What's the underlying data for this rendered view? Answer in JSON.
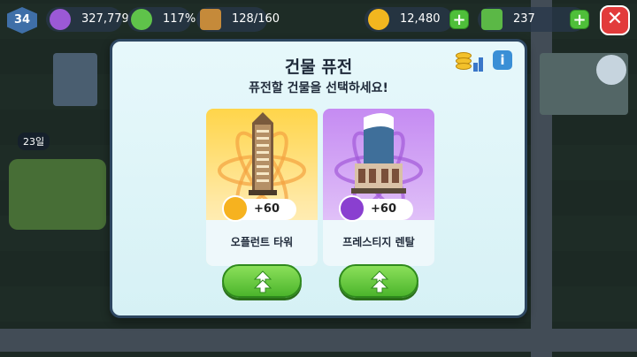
{
  "hud": {
    "level": "34",
    "population": "327,779",
    "happiness": "117%",
    "storage": "128/160",
    "coins": "12,480",
    "cash": "237",
    "close_label": "✕"
  },
  "world": {
    "day_label": "23일"
  },
  "modal": {
    "title": "건물 퓨전",
    "subtitle": "퓨전할 건물을 선택하세요!",
    "info_label": "i",
    "options": [
      {
        "name": "오플런트 타워",
        "reward": "+60",
        "reward_icon": "coin-icon",
        "color": "#ffd54a"
      },
      {
        "name": "프레스티지 렌탈",
        "reward": "+60",
        "reward_icon": "prestige-icon",
        "color": "#c58bf2"
      }
    ]
  },
  "colors": {
    "accent_green": "#4cb52c",
    "close_red": "#e23b3b",
    "info_blue": "#3a8fd6"
  }
}
